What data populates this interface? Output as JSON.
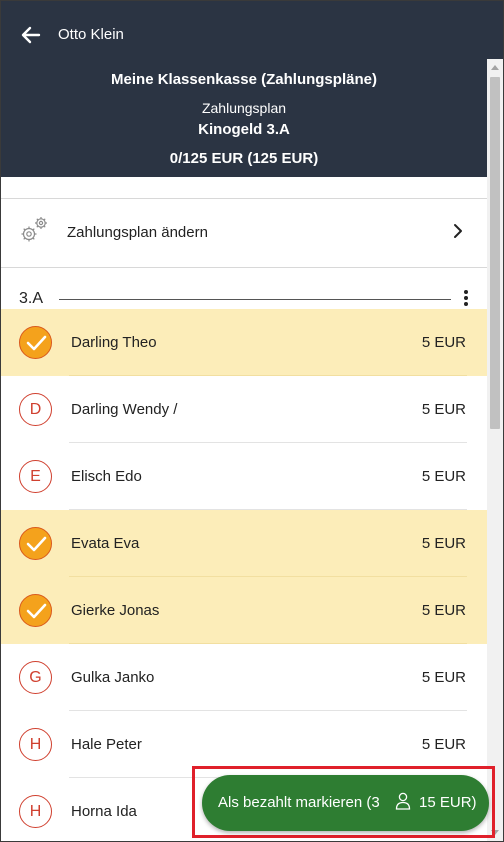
{
  "header": {
    "user": "Otto Klein",
    "title": "Meine Klassenkasse (Zahlungspläne)",
    "subtitle": "Zahlungsplan",
    "plan_name": "Kinogeld 3.A",
    "amount": "0/125 EUR (125 EUR)"
  },
  "settings": {
    "label": "Zahlungsplan ändern"
  },
  "group": {
    "name": "3.A"
  },
  "students": [
    {
      "name": "Darling Theo",
      "price": "5 EUR",
      "selected": true,
      "initial": "D"
    },
    {
      "name": "Darling Wendy /",
      "price": "5 EUR",
      "selected": false,
      "initial": "D"
    },
    {
      "name": "Elisch Edo",
      "price": "5 EUR",
      "selected": false,
      "initial": "E"
    },
    {
      "name": "Evata Eva",
      "price": "5 EUR",
      "selected": true,
      "initial": "E"
    },
    {
      "name": "Gierke Jonas",
      "price": "5 EUR",
      "selected": true,
      "initial": "G"
    },
    {
      "name": "Gulka Janko",
      "price": "5 EUR",
      "selected": false,
      "initial": "G"
    },
    {
      "name": "Hale Peter",
      "price": "5 EUR",
      "selected": false,
      "initial": "H"
    },
    {
      "name": "Horna Ida",
      "price": "",
      "selected": false,
      "initial": "H"
    }
  ],
  "action": {
    "label_part1": "Als bezahlt markieren (3",
    "label_part2": "15 EUR)"
  },
  "colors": {
    "header_bg": "#2b3443",
    "selected_row_bg": "#fcedb9",
    "check_fill": "#f4a21c",
    "initial_circle": "#d0402f",
    "action_button": "#2e7d32",
    "highlight_border": "#e0202a"
  }
}
